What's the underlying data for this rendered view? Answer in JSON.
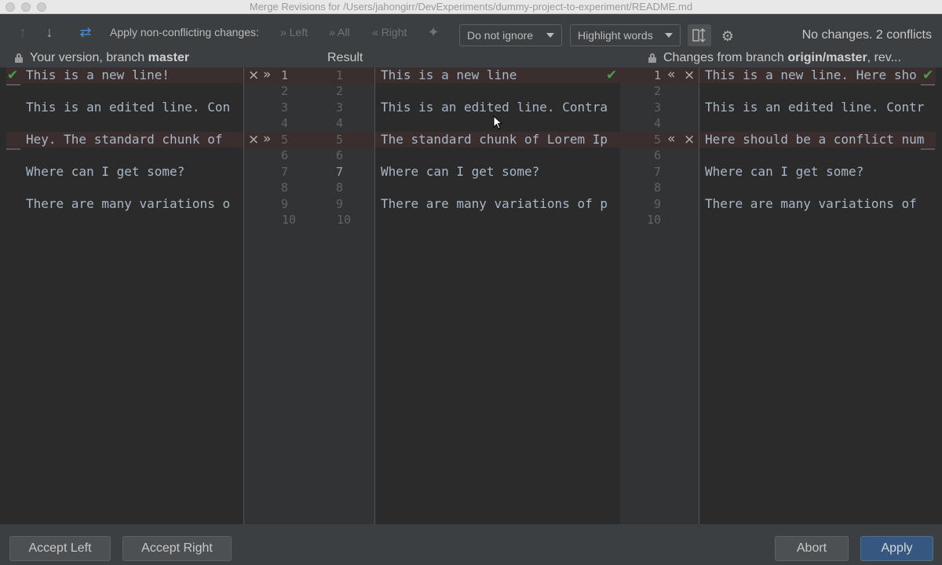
{
  "window": {
    "title": "Merge Revisions for /Users/jahongirr/DevExperiments/dummy-project-to-experiment/README.md"
  },
  "toolbar": {
    "apply_label": "Apply non-conflicting changes:",
    "left": "Left",
    "all": "All",
    "right": "Right",
    "ignore_select": "Do not ignore",
    "highlight_select": "Highlight words",
    "status": "No changes. 2 conflicts"
  },
  "headers": {
    "left_prefix": "Your version, branch ",
    "left_branch": "master",
    "center": "Result",
    "right_prefix": "Changes from branch ",
    "right_branch": "origin/master",
    "right_suffix": ", rev..."
  },
  "left_pane": {
    "lines": [
      "This is a new line!",
      "",
      "This is an edited line. Con",
      "",
      "Hey. The standard chunk of",
      "",
      "Where can I get some?",
      "",
      "There are many variations o",
      ""
    ]
  },
  "result_pane": {
    "lines": [
      "This is a new line",
      "",
      "This is an edited line. Contra",
      "",
      "The standard chunk of Lorem Ip",
      "",
      "Where can I get some?",
      "",
      "There are many variations of p",
      ""
    ]
  },
  "right_pane": {
    "lines": [
      "This is a new line. Here sho",
      "",
      "This is an edited line. Contr",
      "",
      "Here should be a conflict num",
      "",
      "Where can I get some?",
      "",
      "There are many variations of",
      ""
    ]
  },
  "line_numbers": {
    "left": [
      "1",
      "2",
      "3",
      "4",
      "5",
      "6",
      "7",
      "8",
      "9",
      "10"
    ],
    "result": [
      "1",
      "2",
      "3",
      "4",
      "5",
      "6",
      "7",
      "8",
      "9",
      "10"
    ],
    "right": [
      "1",
      "2",
      "3",
      "4",
      "5",
      "6",
      "7",
      "8",
      "9",
      "10"
    ]
  },
  "gutter_markers": {
    "close": "×",
    "apply_right": "»",
    "apply_left": "«",
    "check": "✔"
  },
  "buttons": {
    "accept_left": "Accept Left",
    "accept_right": "Accept Right",
    "abort": "Abort",
    "apply": "Apply"
  },
  "colors": {
    "conflict_row": "#3a2e2e",
    "apply_button": "#365880",
    "check": "#4f9a4f"
  }
}
